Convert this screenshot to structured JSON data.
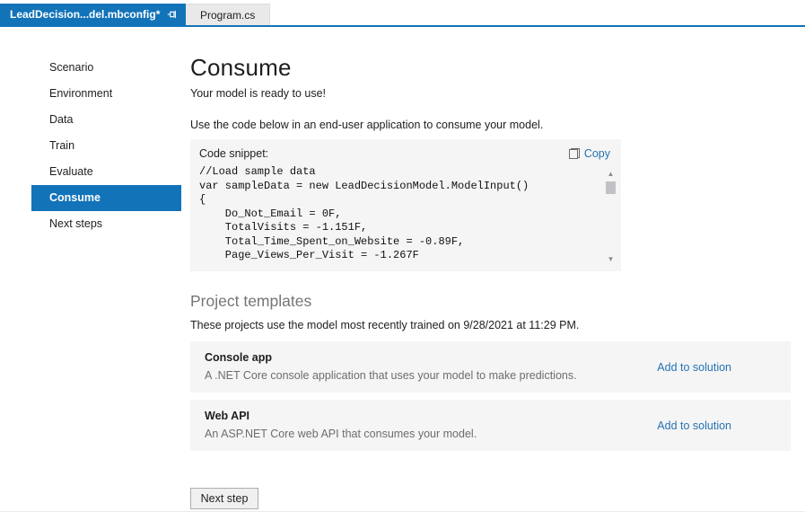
{
  "tabs": [
    {
      "label": "LeadDecision...del.mbconfig*",
      "active": true
    },
    {
      "label": "Program.cs",
      "active": false
    }
  ],
  "sidebar": {
    "items": [
      {
        "label": "Scenario",
        "active": false
      },
      {
        "label": "Environment",
        "active": false
      },
      {
        "label": "Data",
        "active": false
      },
      {
        "label": "Train",
        "active": false
      },
      {
        "label": "Evaluate",
        "active": false
      },
      {
        "label": "Consume",
        "active": true
      },
      {
        "label": "Next steps",
        "active": false
      }
    ]
  },
  "main": {
    "title": "Consume",
    "subtitle": "Your model is ready to use!",
    "instruction": "Use the code below in an end-user application to consume your model.",
    "code_panel": {
      "label": "Code snippet:",
      "copy_label": "Copy",
      "lines": [
        "//Load sample data",
        "var sampleData = new LeadDecisionModel.ModelInput()",
        "{",
        "    Do_Not_Email = 0F,",
        "    TotalVisits = -1.151F,",
        "    Total_Time_Spent_on_Website = -0.89F,",
        "    Page_Views_Per_Visit = -1.267F"
      ]
    },
    "project_templates": {
      "heading": "Project templates",
      "trained_note": "These projects use the model most recently trained on 9/28/2021 at 11:29 PM.",
      "templates": [
        {
          "name": "Console app",
          "description": "A .NET Core console application that uses your model to make predictions.",
          "action": "Add to solution"
        },
        {
          "name": "Web API",
          "description": "An ASP.NET Core web API that consumes your model.",
          "action": "Add to solution"
        }
      ]
    },
    "next_step_label": "Next step"
  },
  "icons": {
    "pin": "pin-icon",
    "close": "✕",
    "scroll_up": "▲",
    "scroll_down": "▼"
  },
  "colors": {
    "accent": "#1273b8",
    "link": "#2473b4",
    "panel_bg": "#f5f5f5",
    "text": "#1e1e1e",
    "muted": "#6d6d6d"
  }
}
